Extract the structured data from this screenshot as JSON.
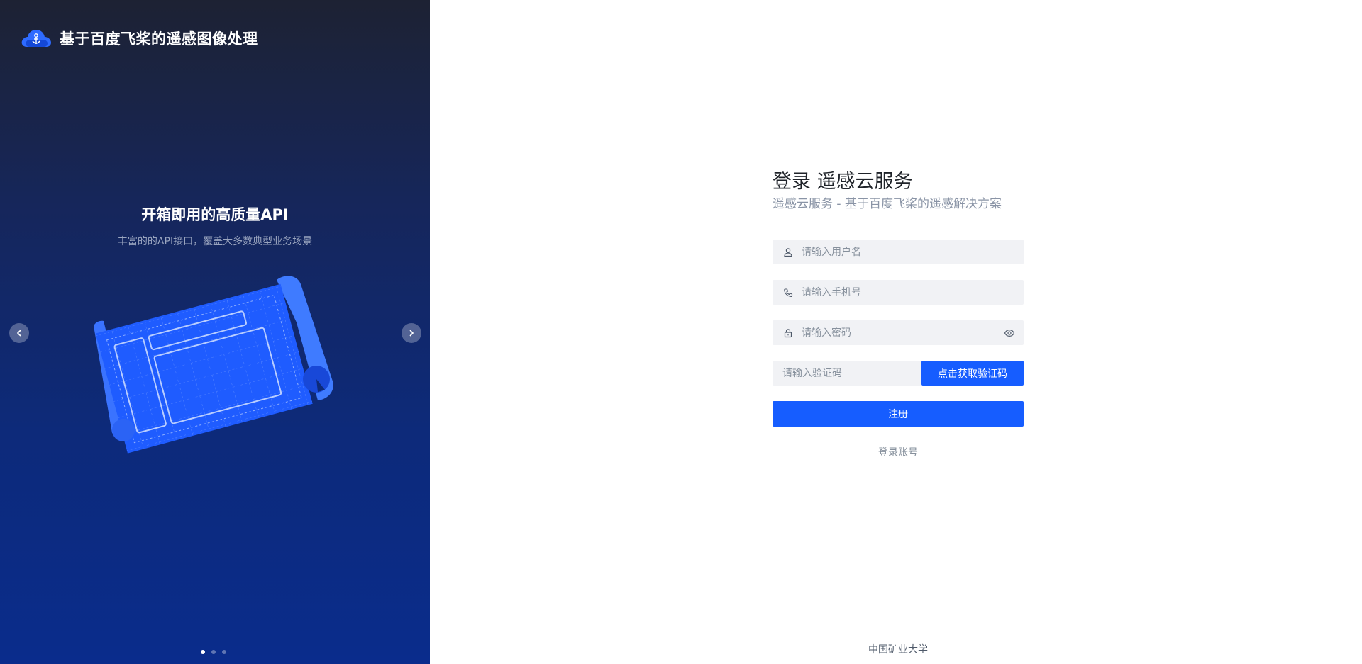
{
  "brand": {
    "title": "基于百度飞桨的遥感图像处理",
    "logo_icon": "cloud-logo-icon"
  },
  "carousel": {
    "title": "开箱即用的高质量API",
    "subtitle": "丰富的的API接口，覆盖大多数典型业务场景",
    "prev_icon": "chevron-left-icon",
    "next_icon": "chevron-right-icon",
    "slide_count": 3,
    "active_index": 0
  },
  "form": {
    "title": "登录 遥感云服务",
    "subtitle": "遥感云服务 - 基于百度飞桨的遥感解决方案",
    "username": {
      "placeholder": "请输入用户名",
      "value": "",
      "icon": "user-icon"
    },
    "phone": {
      "placeholder": "请输入手机号",
      "value": "",
      "icon": "phone-icon"
    },
    "password": {
      "placeholder": "请输入密码",
      "value": "",
      "icon": "lock-icon",
      "toggle_icon": "eye-icon"
    },
    "code": {
      "placeholder": "请输入验证码",
      "value": ""
    },
    "get_code_label": "点击获取验证码",
    "submit_label": "注册",
    "login_link": "登录账号"
  },
  "footer": {
    "text": "中国矿业大学"
  },
  "colors": {
    "primary": "#165dff",
    "input_bg": "#f1f2f5",
    "panel_dark": "#1d2233",
    "panel_blue": "#0a2c8c"
  }
}
